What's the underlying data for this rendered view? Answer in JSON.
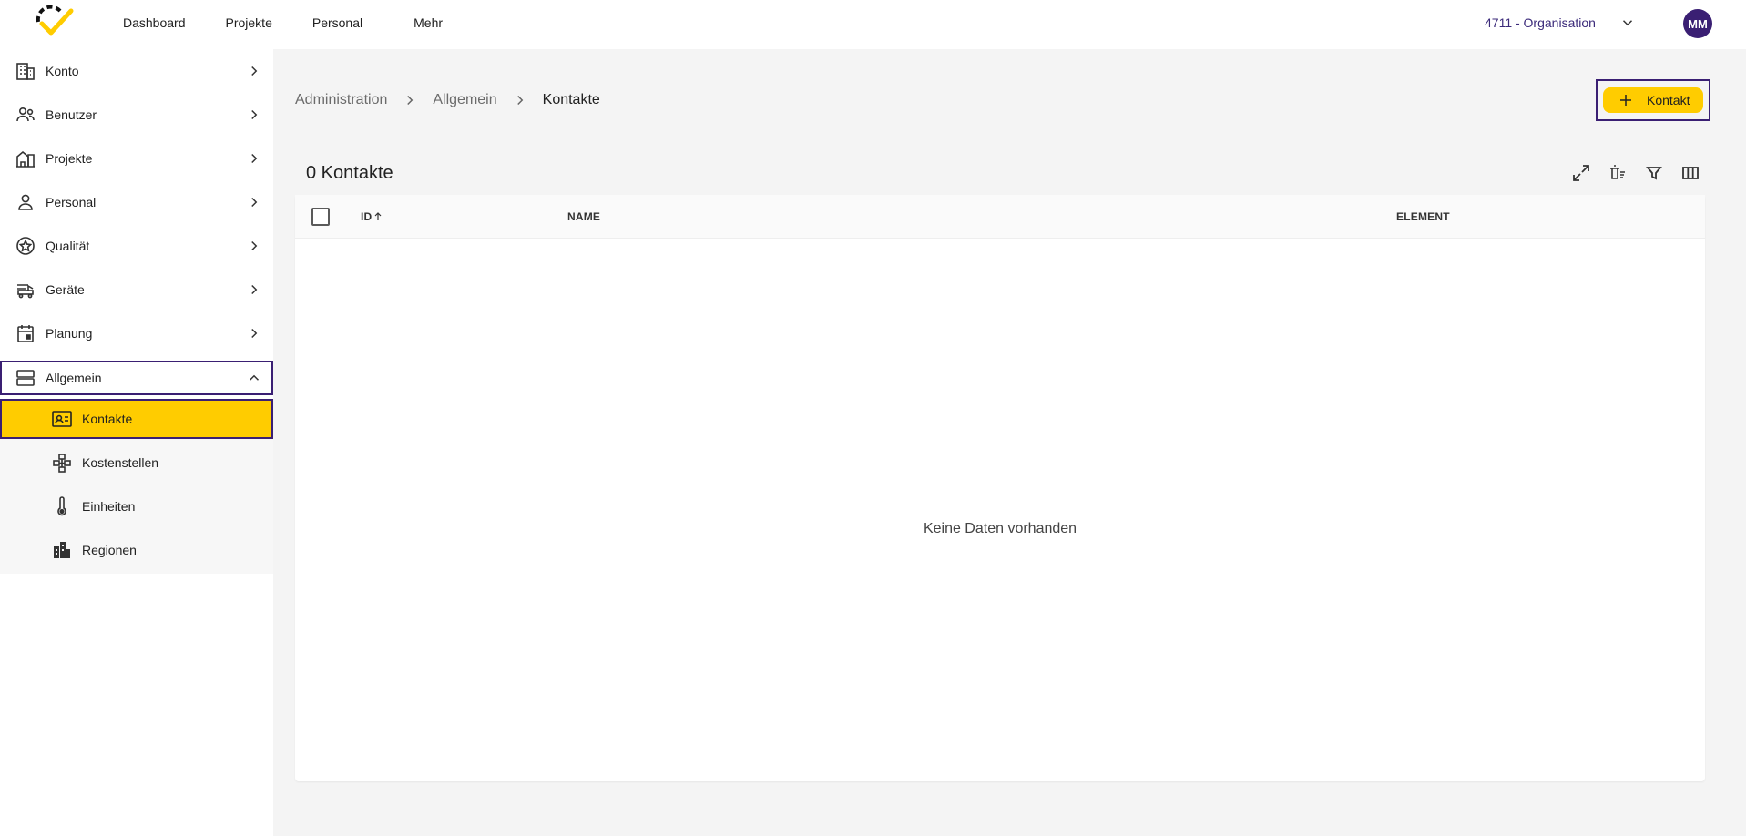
{
  "topnav": {
    "items": [
      "Dashboard",
      "Projekte",
      "Personal",
      "Mehr"
    ]
  },
  "header": {
    "organization": "4711 - Organisation",
    "avatar_initials": "MM"
  },
  "sidebar": {
    "items": [
      {
        "label": "Konto",
        "icon": "building-icon"
      },
      {
        "label": "Benutzer",
        "icon": "users-icon"
      },
      {
        "label": "Projekte",
        "icon": "house-icon"
      },
      {
        "label": "Personal",
        "icon": "person-icon"
      },
      {
        "label": "Qualität",
        "icon": "star-badge-icon"
      },
      {
        "label": "Geräte",
        "icon": "vehicle-icon"
      },
      {
        "label": "Planung",
        "icon": "calendar-icon"
      },
      {
        "label": "Allgemein",
        "icon": "server-icon"
      }
    ],
    "subitems": [
      {
        "label": "Kontakte",
        "icon": "contact-card-icon"
      },
      {
        "label": "Kostenstellen",
        "icon": "hierarchy-icon"
      },
      {
        "label": "Einheiten",
        "icon": "thermometer-icon"
      },
      {
        "label": "Regionen",
        "icon": "city-icon"
      }
    ]
  },
  "breadcrumb": [
    "Administration",
    "Allgemein",
    "Kontakte"
  ],
  "actions": {
    "add_label": "Kontakt"
  },
  "table": {
    "count_title": "0 Kontakte",
    "columns": [
      "ID",
      "NAME",
      "ELEMENT"
    ],
    "empty_text": "Keine Daten vorhanden"
  },
  "colors": {
    "accent": "#ffcc00",
    "brand": "#3a1f73"
  }
}
